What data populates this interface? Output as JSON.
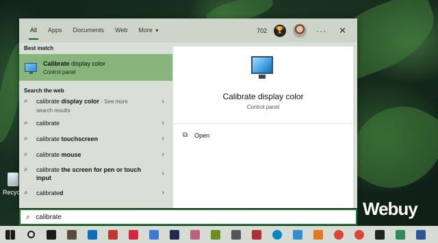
{
  "tabs": [
    "All",
    "Apps",
    "Documents",
    "Web",
    "More"
  ],
  "header": {
    "points": "702"
  },
  "best_match": {
    "section_title": "Best match",
    "title_bold": "Calibrate",
    "title_rest": " display color",
    "subtitle": "Control panel"
  },
  "web": {
    "section_title": "Search the web",
    "rows": [
      {
        "pre": "calibrate ",
        "bold": "display color",
        "suffix": " - See more",
        "sub": "search results"
      },
      {
        "pre": "calibrate",
        "bold": "",
        "suffix": "",
        "sub": ""
      },
      {
        "pre": "calibrate ",
        "bold": "touchscreen",
        "suffix": "",
        "sub": ""
      },
      {
        "pre": "calibrate ",
        "bold": "mouse",
        "suffix": "",
        "sub": ""
      },
      {
        "pre": "calibrate ",
        "bold": "the screen for pen or touch input",
        "suffix": "",
        "sub": ""
      },
      {
        "pre": "calibrate",
        "bold": "d",
        "suffix": "",
        "sub": ""
      }
    ]
  },
  "preview": {
    "title": "Calibrate display color",
    "category": "Control panel",
    "action": "Open"
  },
  "search": {
    "value": "calibrate"
  },
  "desktop": {
    "recycle_label": "Recycle",
    "watermark": "Webuy"
  },
  "colors": {
    "accent": "#1f7a3a",
    "best_match_bg": "#87b57c",
    "panel_bg": "#d9dfd7"
  },
  "taskbar": {
    "items": [
      {
        "name": "windows-start-icon",
        "color": "#1a1a1a"
      },
      {
        "name": "search-icon",
        "color": "#1a1a1a"
      },
      {
        "name": "task-view-icon",
        "color": "#1a1a1a"
      },
      {
        "name": "app-icon",
        "color": "#5a4a3a"
      },
      {
        "name": "outlook-icon",
        "color": "#0f6cbd"
      },
      {
        "name": "app-icon",
        "color": "#c0392b"
      },
      {
        "name": "app-icon",
        "color": "#d6263a"
      },
      {
        "name": "store-icon",
        "color": "#3a7bd5"
      },
      {
        "name": "photoshop-icon",
        "color": "#1d2a52"
      },
      {
        "name": "app-icon",
        "color": "#c06080"
      },
      {
        "name": "vectorworks-icon",
        "color": "#6a8f20"
      },
      {
        "name": "app-icon",
        "color": "#555555"
      },
      {
        "name": "app-icon",
        "color": "#b03030"
      },
      {
        "name": "edge-icon",
        "color": "#0a84c8"
      },
      {
        "name": "app-icon",
        "color": "#2f8fd0"
      },
      {
        "name": "app-icon",
        "color": "#e07a1a"
      },
      {
        "name": "chrome-icon",
        "color": "#db4437"
      },
      {
        "name": "chrome-icon",
        "color": "#db4437"
      },
      {
        "name": "security-icon",
        "color": "#222222"
      },
      {
        "name": "app-icon",
        "color": "#2e8b57"
      },
      {
        "name": "word-icon",
        "color": "#2b579a"
      }
    ]
  }
}
